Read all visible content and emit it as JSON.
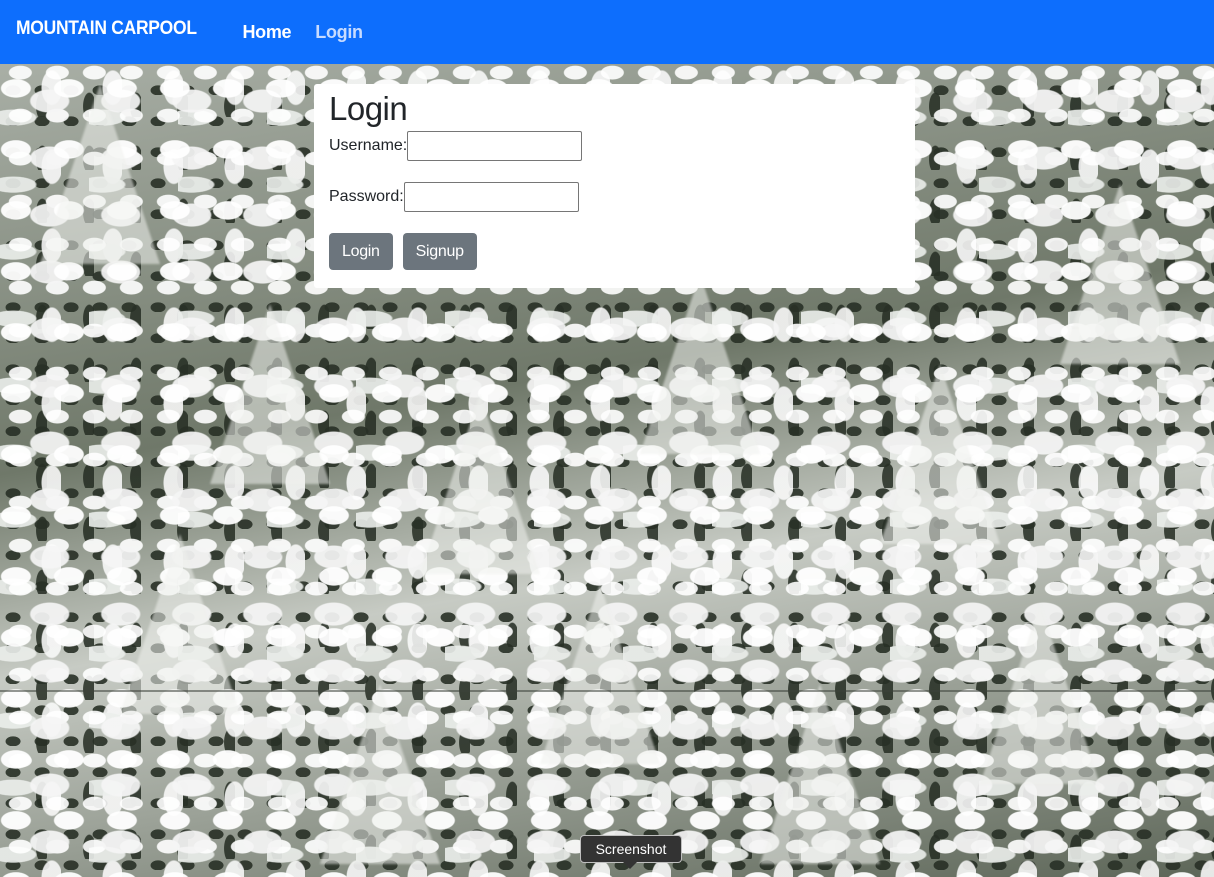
{
  "navbar": {
    "brand": "MOUNTAIN CARPOOL",
    "links": [
      {
        "label": "Home"
      },
      {
        "label": "Login"
      }
    ],
    "color": "#0d6efd"
  },
  "login": {
    "title": "Login",
    "username_label": "Username:",
    "username_value": "",
    "password_label": "Password:",
    "password_value": "",
    "login_button": "Login",
    "signup_button": "Signup",
    "button_color": "#6c757d"
  },
  "background": {
    "icon": "snowy-forest-image"
  },
  "tooltip": {
    "label": "Screenshot"
  }
}
